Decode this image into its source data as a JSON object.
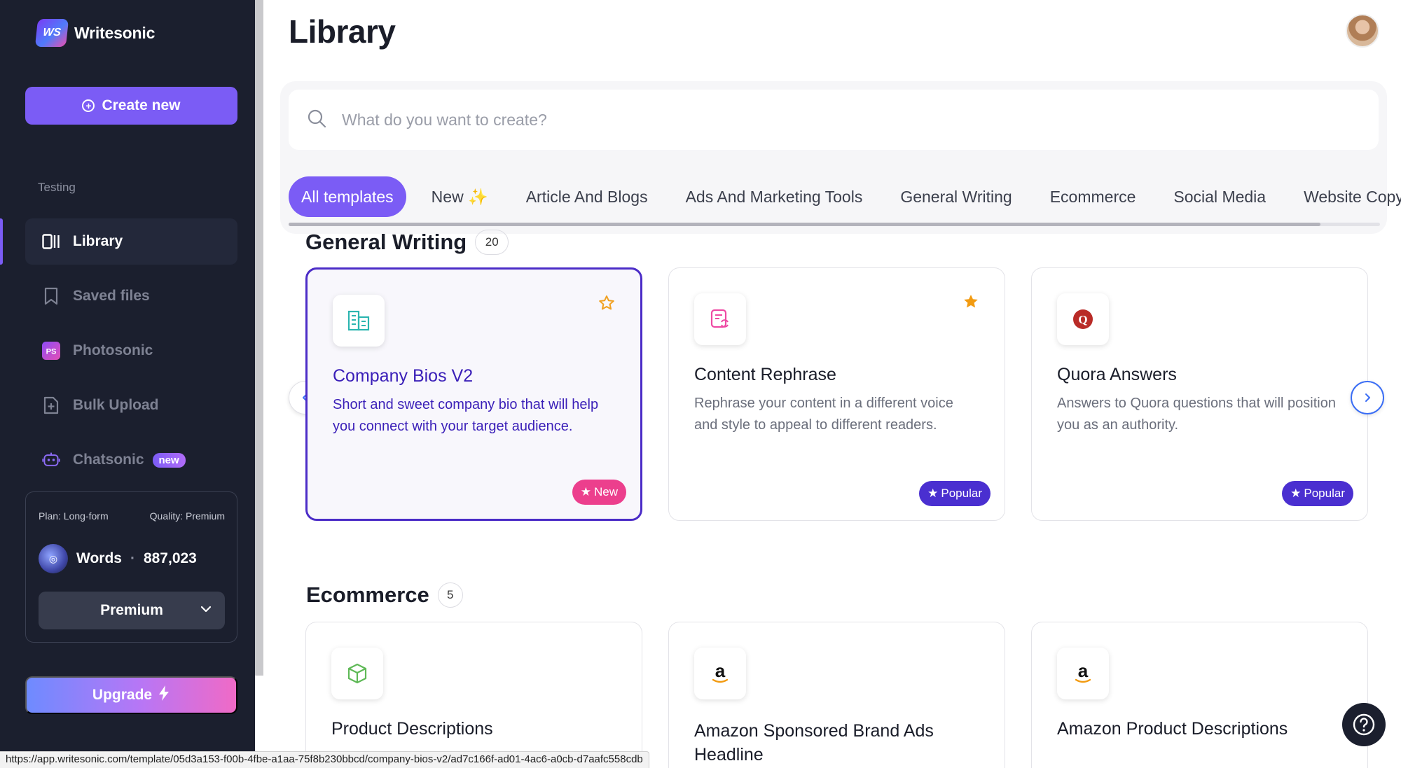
{
  "app": {
    "name": "Writesonic",
    "logo_text": "WS"
  },
  "sidebar": {
    "create_label": "Create new",
    "section_label": "Testing",
    "items": [
      {
        "label": "Library",
        "icon": "library-icon",
        "active": true
      },
      {
        "label": "Saved files",
        "icon": "bookmark-icon"
      },
      {
        "label": "Photosonic",
        "icon": "photosonic-icon"
      },
      {
        "label": "Bulk Upload",
        "icon": "file-plus-icon"
      },
      {
        "label": "Chatsonic",
        "icon": "robot-icon",
        "badge": "new"
      }
    ],
    "plan": {
      "plan_text": "Plan: Long-form",
      "quality_text": "Quality: Premium",
      "words_label": "Words",
      "words_dot": "·",
      "words_count": "887,023",
      "select_value": "Premium"
    },
    "upgrade_label": "Upgrade"
  },
  "main": {
    "title": "Library",
    "search_placeholder": "What do you want to create?",
    "tabs": [
      "All templates",
      "New ✨",
      "Article And Blogs",
      "Ads And Marketing Tools",
      "General Writing",
      "Ecommerce",
      "Social Media",
      "Website Copy"
    ],
    "sections": [
      {
        "title": "General Writing",
        "count": "20",
        "cards": [
          {
            "title": "Company Bios V2",
            "desc": "Short and sweet company bio that will help you connect with your target audience.",
            "badge": "New",
            "star": "outline",
            "icon": "building-icon"
          },
          {
            "title": "Content Rephrase",
            "desc": "Rephrase your content in a different voice and style to appeal to different readers.",
            "badge": "Popular",
            "star": "filled",
            "icon": "rephrase-icon"
          },
          {
            "title": "Quora Answers",
            "desc": "Answers to Quora questions that will position you as an authority.",
            "badge": "Popular",
            "icon": "quora-icon"
          }
        ]
      },
      {
        "title": "Ecommerce",
        "count": "5",
        "cards": [
          {
            "title": "Product Descriptions",
            "icon": "box-icon"
          },
          {
            "title": "Amazon Sponsored Brand Ads Headline",
            "icon": "amazon-icon"
          },
          {
            "title": "Amazon Product Descriptions",
            "icon": "amazon-icon"
          }
        ]
      }
    ]
  },
  "statusbar": {
    "url": "https://app.writesonic.com/template/05d3a153-f00b-4fbe-a1aa-75f8b230bbcd/company-bios-v2/ad7c166f-ad01-4ac6-a0cb-d7aafc558cdb"
  },
  "colors": {
    "sidebar_bg": "#1b1f2e",
    "accent": "#7b5cf5",
    "popular_badge": "#4a2fd0",
    "new_badge": "#ec3f8d",
    "selected_border": "#4b2cc7"
  }
}
